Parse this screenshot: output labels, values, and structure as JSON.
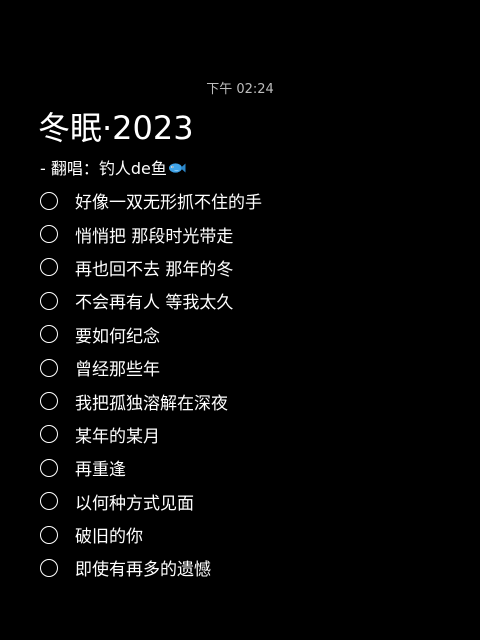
{
  "status_bar": {
    "time": "下午 02:24"
  },
  "note": {
    "title": "冬眠·2023",
    "subtitle": "-  翻唱：钓人de鱼",
    "subtitle_icon": "fish-emoji-icon",
    "checklist": [
      {
        "label": "好像一双无形抓不住的手",
        "checked": false
      },
      {
        "label": "悄悄把 那段时光带走",
        "checked": false
      },
      {
        "label": "再也回不去 那年的冬",
        "checked": false
      },
      {
        "label": "不会再有人 等我太久",
        "checked": false
      },
      {
        "label": "要如何纪念",
        "checked": false
      },
      {
        "label": "曾经那些年",
        "checked": false
      },
      {
        "label": "我把孤独溶解在深夜",
        "checked": false
      },
      {
        "label": "某年的某月",
        "checked": false
      },
      {
        "label": "再重逢",
        "checked": false
      },
      {
        "label": "以何种方式见面",
        "checked": false
      },
      {
        "label": "破旧的你",
        "checked": false
      },
      {
        "label": "即使有再多的遗憾",
        "checked": false
      }
    ]
  },
  "colors": {
    "background": "#000000",
    "text": "#ffffff",
    "status_text": "#bdbdbd",
    "fish_icon": "#3fa3e8"
  }
}
